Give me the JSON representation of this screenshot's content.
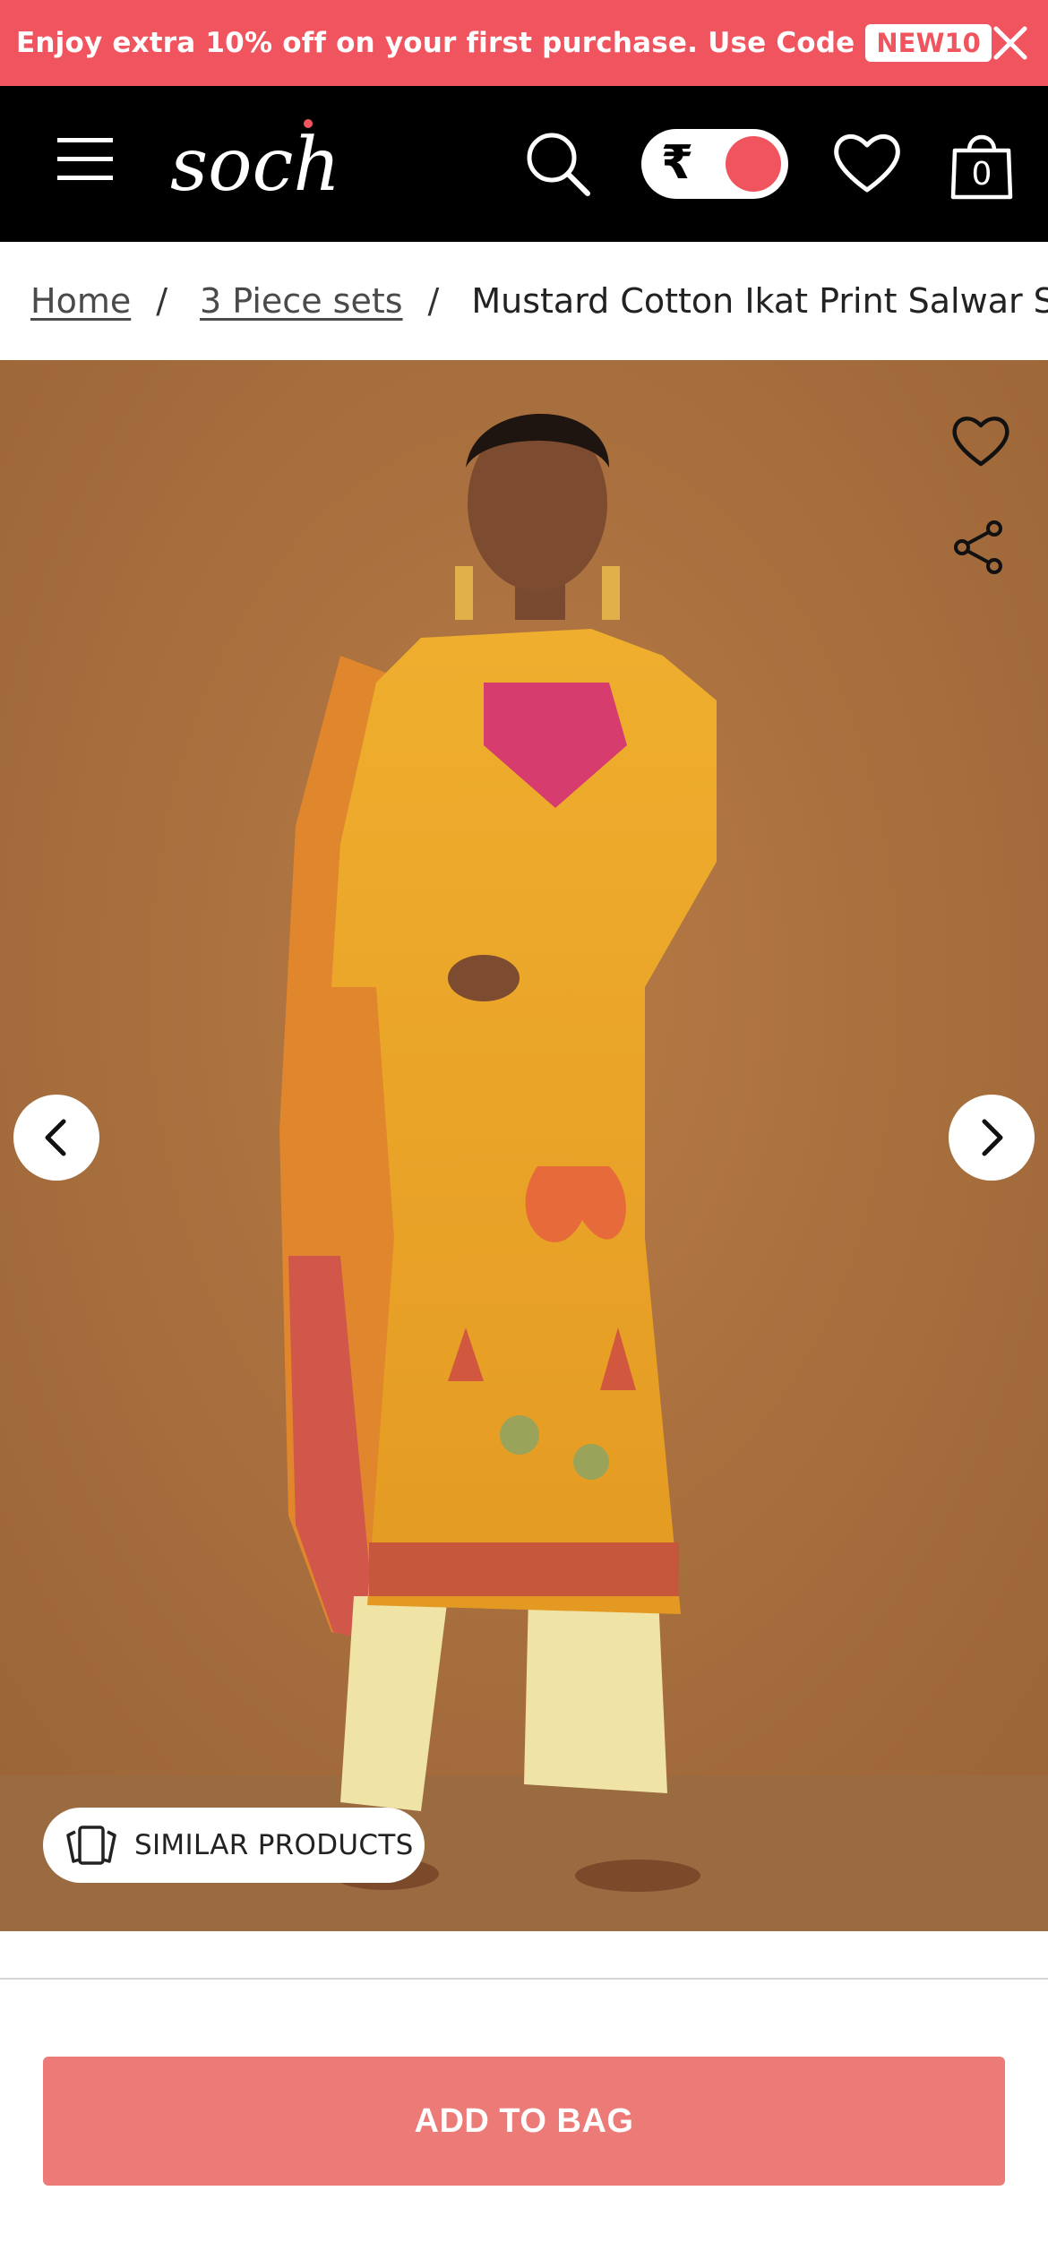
{
  "promo": {
    "text": "Enjoy extra 10% off on your first purchase. Use Code",
    "code": "NEW10",
    "close_icon": "close-icon"
  },
  "header": {
    "logo_text": "soch",
    "currency_symbol": "₹",
    "bag_count": "0",
    "icons": [
      "menu-icon",
      "search-icon",
      "currency-toggle",
      "heart-icon",
      "bag-icon"
    ]
  },
  "breadcrumb": {
    "items": [
      {
        "label": "Home"
      },
      {
        "label": "3 Piece sets"
      }
    ],
    "separator": "/",
    "current": "Mustard Cotton Ikat Print Salwar Suit"
  },
  "gallery": {
    "similar_label": "SIMILAR PRODUCTS",
    "icons": [
      "heart-icon",
      "share-icon",
      "chevron-left-icon",
      "chevron-right-icon",
      "similar-products-icon"
    ]
  },
  "cta": {
    "add_to_bag_label": "ADD TO BAG"
  },
  "colors": {
    "brand": "#f0555f",
    "header_bg": "#000000",
    "cta_bg": "#ec7b78",
    "photo_bg": "#a8703f",
    "kurta": "#e9a326"
  }
}
